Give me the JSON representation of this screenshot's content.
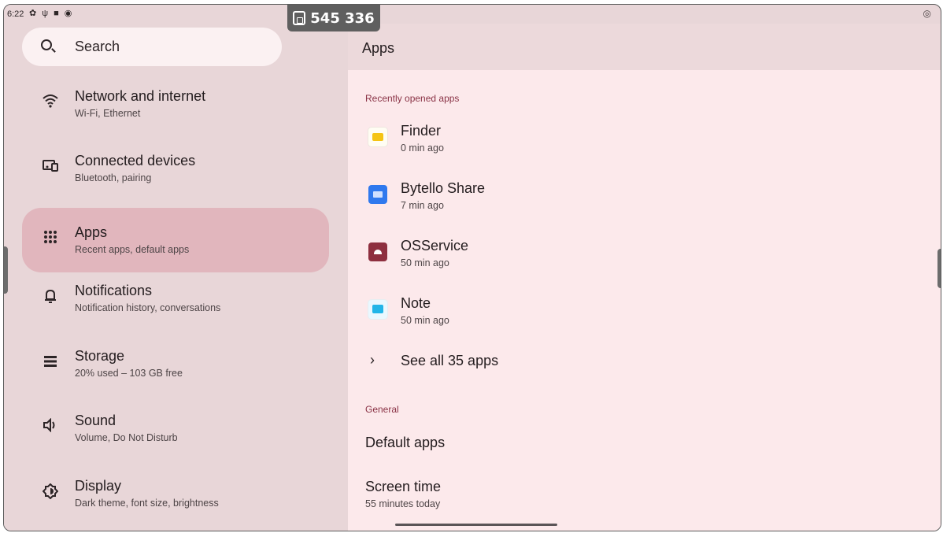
{
  "status_bar": {
    "time": "6:22",
    "icons": [
      "settings-icon",
      "usb-icon",
      "square-icon",
      "circle-icon"
    ],
    "right_icon": "hotspot-icon"
  },
  "session_code": "545 336",
  "search": {
    "label": "Search"
  },
  "nav": [
    {
      "title": "Network and internet",
      "subtitle": "Wi-Fi, Ethernet",
      "icon": "wifi-icon"
    },
    {
      "title": "Connected devices",
      "subtitle": "Bluetooth, pairing",
      "icon": "devices-icon"
    },
    {
      "title": "Apps",
      "subtitle": "Recent apps, default apps",
      "icon": "apps-grid-icon",
      "active": true
    },
    {
      "title": "Notifications",
      "subtitle": "Notification history, conversations",
      "icon": "bell-icon"
    },
    {
      "title": "Storage",
      "subtitle": "20% used – 103 GB free",
      "icon": "storage-icon"
    },
    {
      "title": "Sound",
      "subtitle": "Volume, Do Not Disturb",
      "icon": "speaker-icon"
    },
    {
      "title": "Display",
      "subtitle": "Dark theme, font size, brightness",
      "icon": "brightness-icon"
    }
  ],
  "header": {
    "title": "Apps"
  },
  "recent": {
    "section_label": "Recently opened apps",
    "apps": [
      {
        "name": "Finder",
        "time": "0 min ago",
        "icon": "finder-icon"
      },
      {
        "name": "Bytello Share",
        "time": "7 min ago",
        "icon": "bytello-share-icon"
      },
      {
        "name": "OSService",
        "time": "50 min ago",
        "icon": "osservice-icon"
      },
      {
        "name": "Note",
        "time": "50 min ago",
        "icon": "note-icon"
      }
    ],
    "see_all": "See all 35 apps"
  },
  "general": {
    "section_label": "General",
    "default_apps": "Default apps",
    "screen_time_title": "Screen time",
    "screen_time_sub": "55 minutes today"
  },
  "colors": {
    "left_bg": "#e8d6d8",
    "right_bg": "#fce9eb",
    "active_item": "#e1b6bd",
    "section_accent": "#8a3346"
  }
}
